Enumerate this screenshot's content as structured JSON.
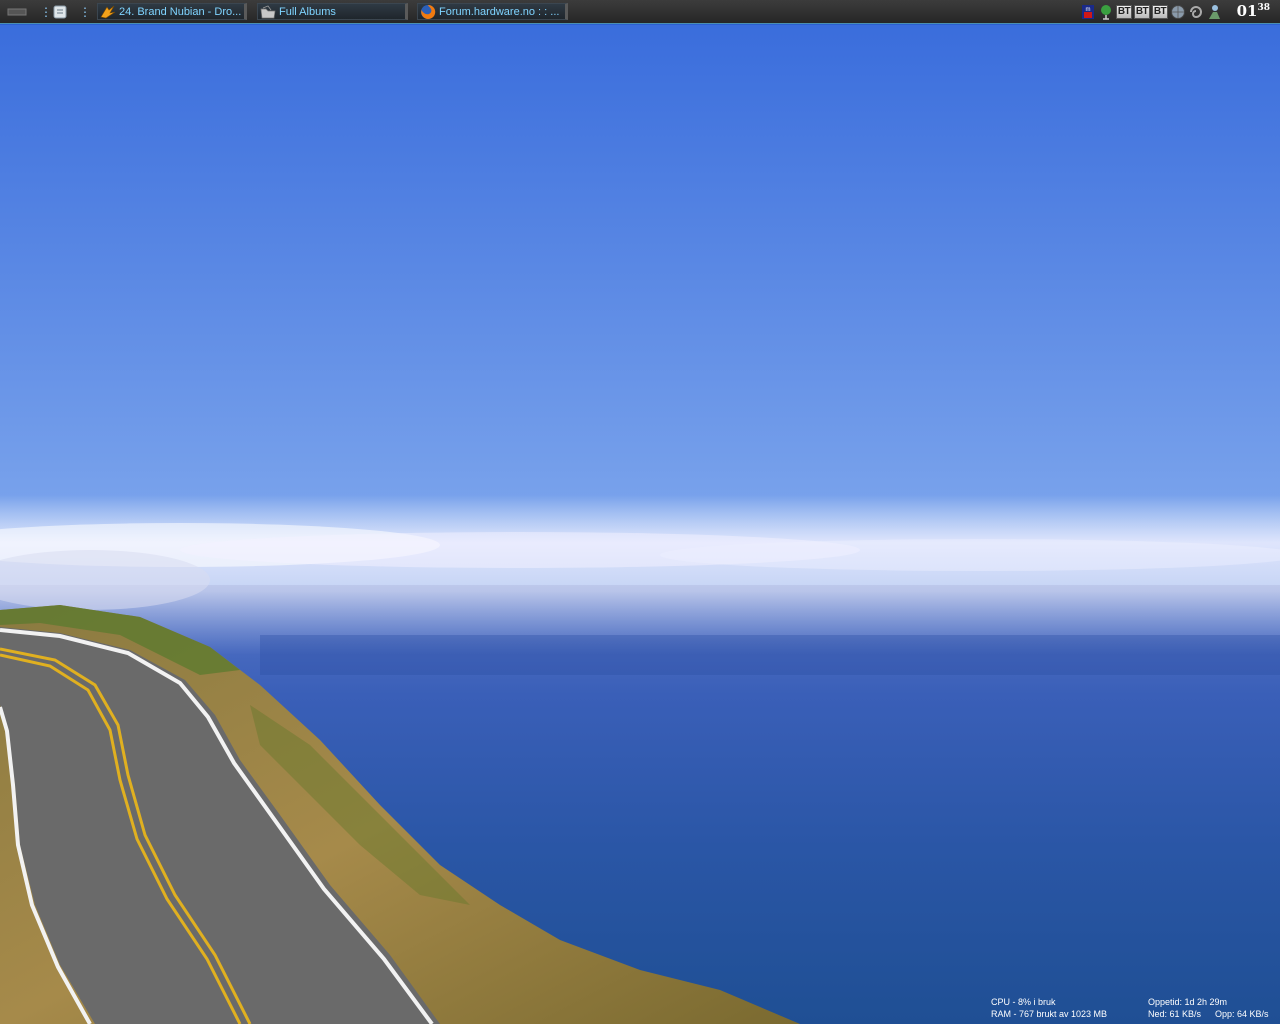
{
  "taskbar": {
    "tasks": [
      {
        "label": "24. Brand Nubian - Dro...",
        "icon": "winamp-icon"
      },
      {
        "label": "Full Albums",
        "icon": "folder-icon"
      },
      {
        "label": "Forum.hardware.no : : ...",
        "icon": "firefox-icon"
      }
    ],
    "tray": {
      "bt_labels": [
        "BT",
        "BT",
        "BT"
      ]
    },
    "clock": {
      "hour": "01",
      "minute": "38"
    }
  },
  "monitor": {
    "cpu": "CPU - 8% i bruk",
    "ram": "RAM - 767 brukt av 1023 MB",
    "uptime": "Oppetid: 1d 2h 29m",
    "down": "Ned: 61 KB/s",
    "up": "Opp: 64 KB/s"
  },
  "colors": {
    "sky_top": "#3a6ddc",
    "sky_bottom": "#b8d0f4",
    "ocean": "#2a56a8",
    "taskbar_text": "#7fd4ff"
  }
}
